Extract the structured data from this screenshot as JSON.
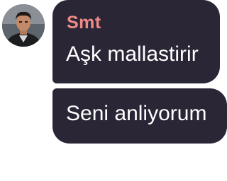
{
  "chat": {
    "sender": {
      "name": "Smt",
      "name_color": "#f08a86",
      "avatar_icon": "user-avatar"
    },
    "messages": [
      {
        "text": "Aşk mallastirir"
      },
      {
        "text": "Seni anliyorum"
      }
    ],
    "bubble_color": "#2a2635"
  }
}
